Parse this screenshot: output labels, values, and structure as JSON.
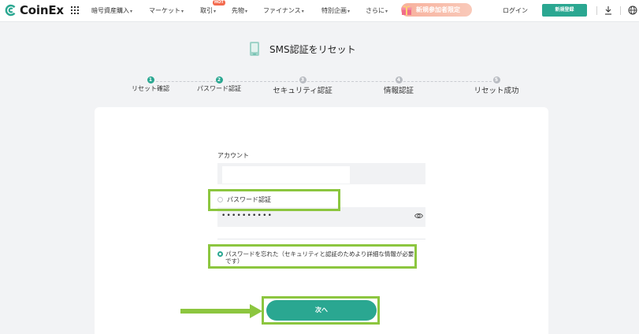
{
  "header": {
    "logo_text": "CoinEx",
    "nav": [
      {
        "label": "暗号資産購入",
        "caret": "▾"
      },
      {
        "label": "マーケット",
        "caret": "▾"
      },
      {
        "label": "取引",
        "caret": "▾",
        "badge": "HOT"
      },
      {
        "label": "先物",
        "caret": "▾"
      },
      {
        "label": "ファイナンス",
        "caret": "▾"
      },
      {
        "label": "特別企画",
        "caret": "▾"
      },
      {
        "label": "さらに",
        "caret": "▾"
      }
    ],
    "promo_label": "新規参加者限定",
    "login_label": "ログイン",
    "register_label": "新規登録"
  },
  "page": {
    "title": "SMS認証をリセット"
  },
  "steps": [
    {
      "number": "1",
      "label": "リセット確認",
      "state": "done"
    },
    {
      "number": "2",
      "label": "パスワード認証",
      "state": "done"
    },
    {
      "number": "3",
      "label": "セキュリティ認証",
      "state": "todo"
    },
    {
      "number": "4",
      "label": "情報認証",
      "state": "todo"
    },
    {
      "number": "5",
      "label": "リセット成功",
      "state": "todo"
    }
  ],
  "form": {
    "account_label": "アカウント",
    "account_value": "",
    "option_password_label": "パスワード認証",
    "password_mask": "••••••••••",
    "option_forgot_label": "パスワードを忘れた（セキュリティと認証のためより詳細な情報が必要です）",
    "next_label": "次へ"
  },
  "colors": {
    "accent": "#2aa791",
    "highlight": "#8cc63f"
  }
}
